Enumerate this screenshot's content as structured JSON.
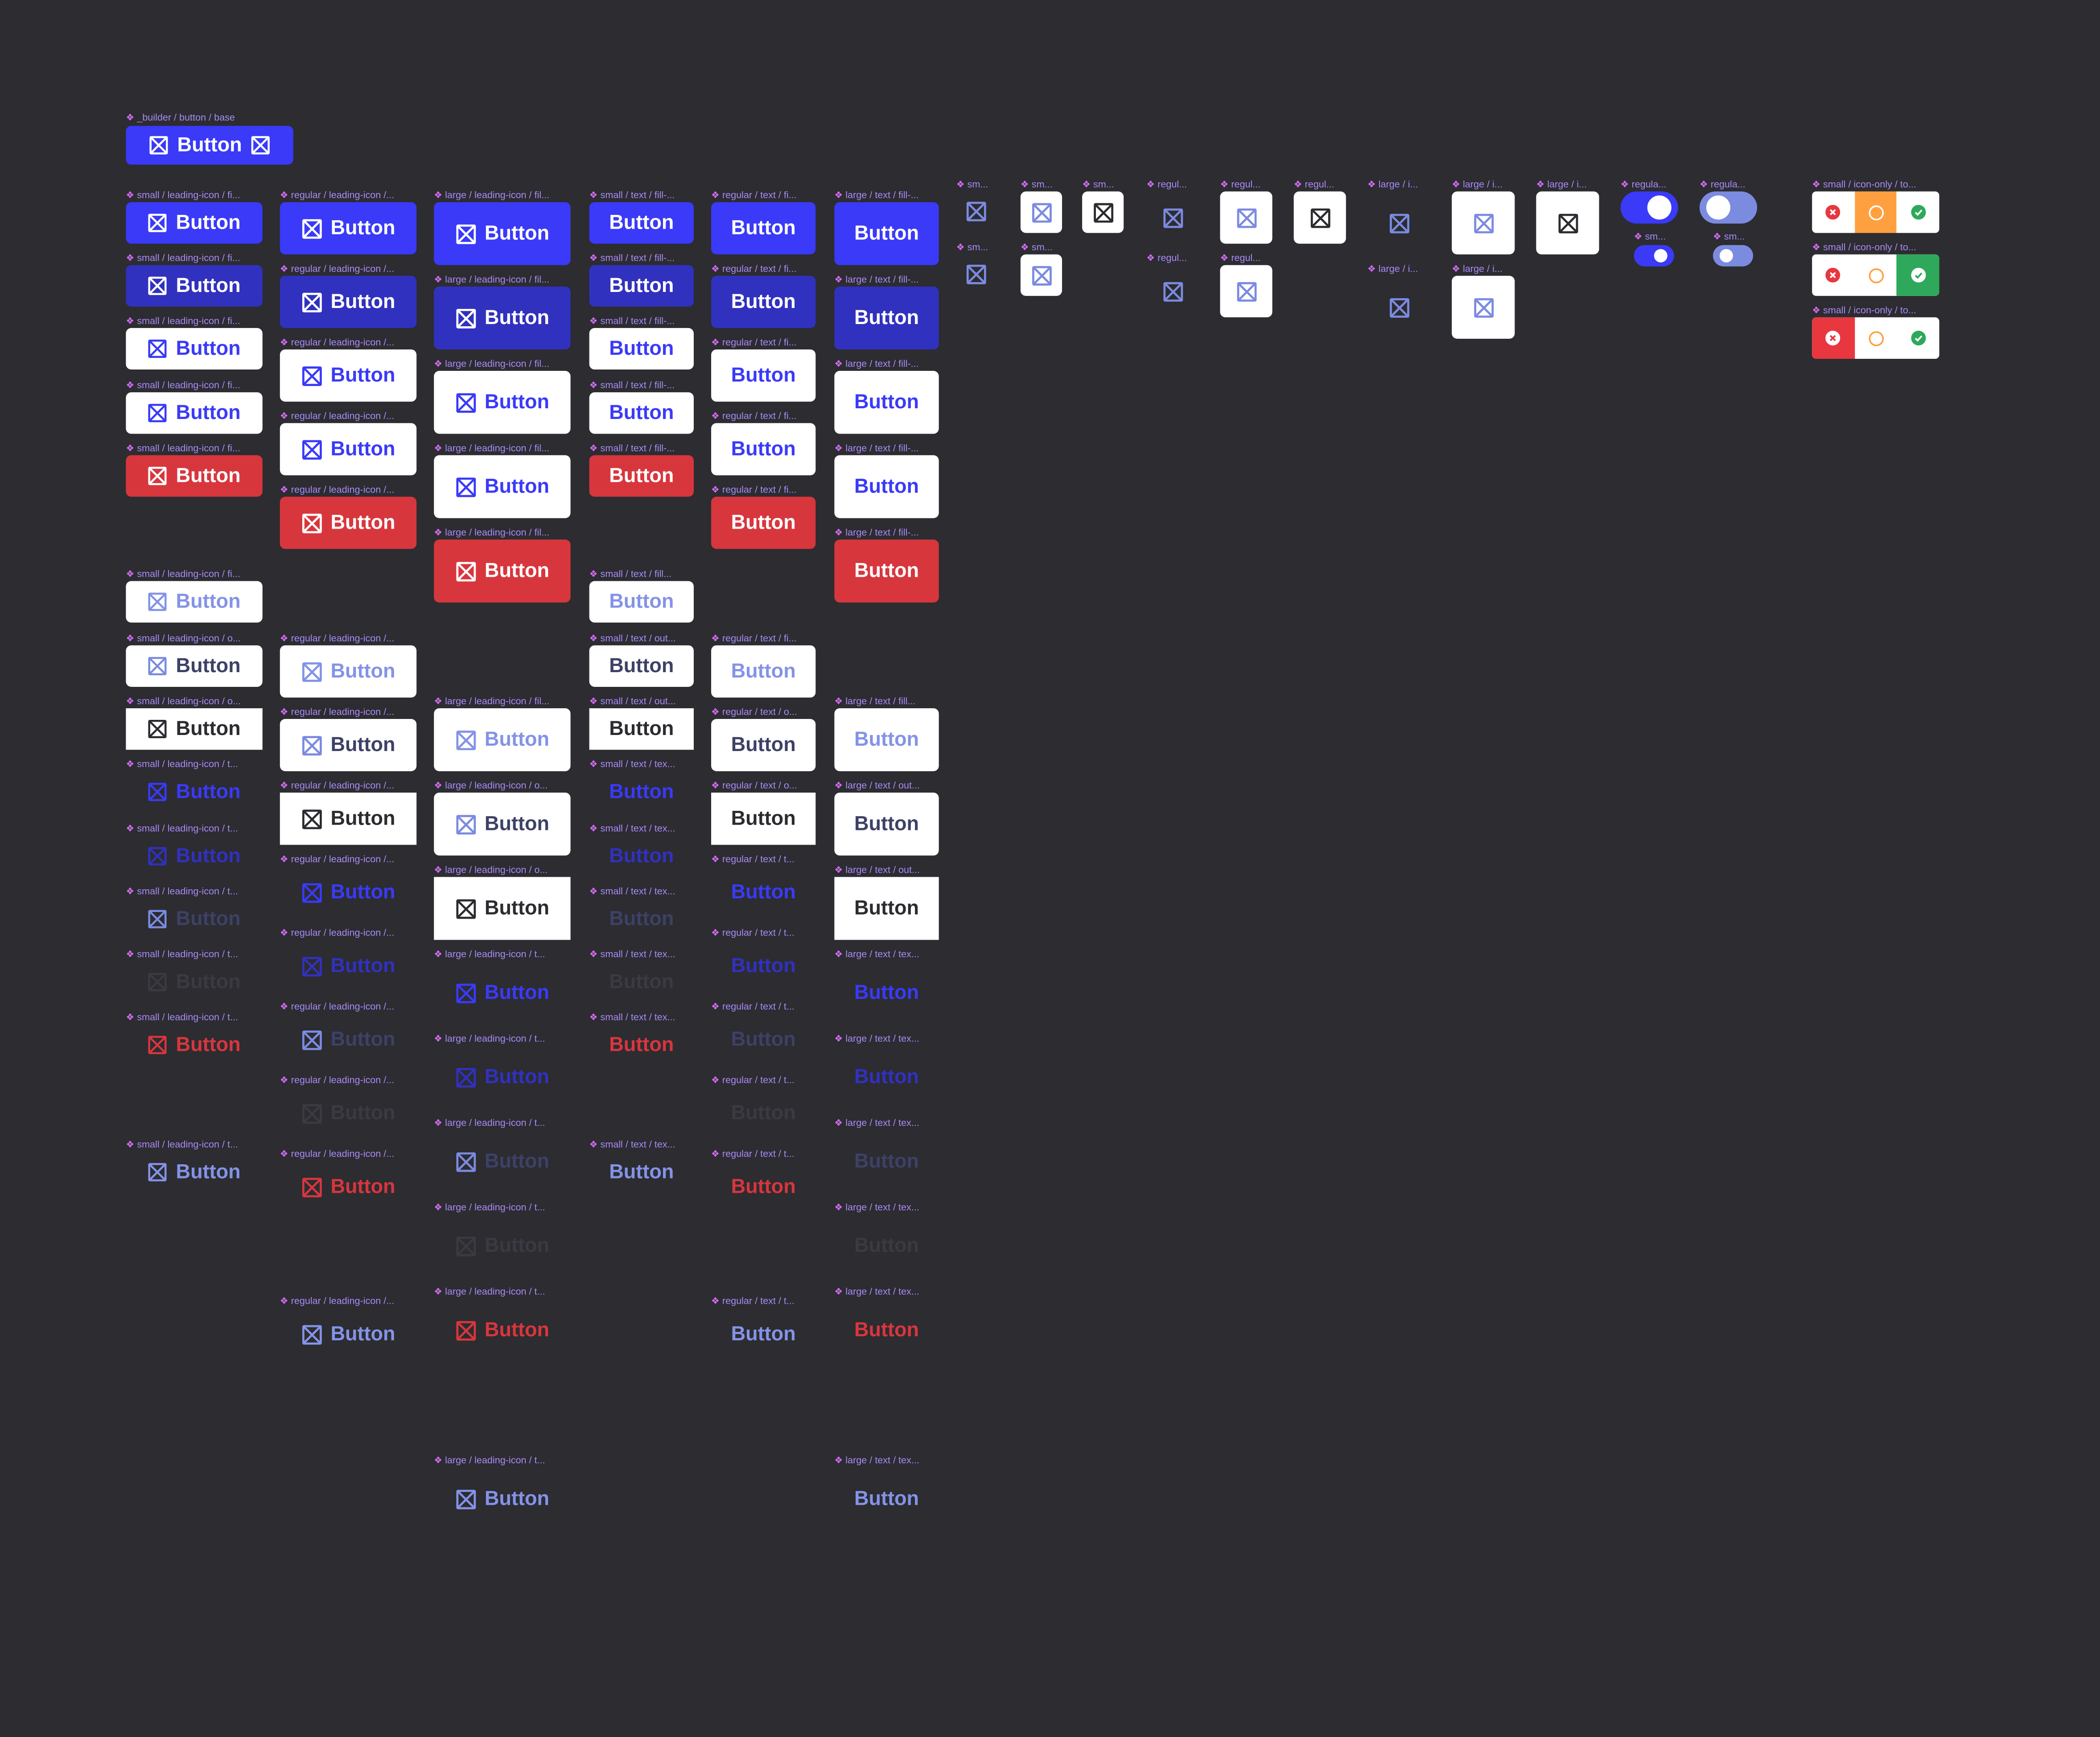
{
  "colors": {
    "background": "#2c2c31",
    "primary": "#3a3af8",
    "pressed": "#3131bf",
    "danger": "#d8363d",
    "muted": "#8493e6",
    "label": "#a98af5",
    "warning": "#ffa040",
    "success": "#2ea85a"
  },
  "builder": {
    "label": "_builder / button / base",
    "text": "Button",
    "icon": "placeholder-x-box-icon"
  },
  "columns": [
    {
      "size": "small",
      "kind": "leading-icon",
      "items": [
        {
          "label": "small / leading-icon / fi...",
          "text": "Button",
          "variant": "fill"
        },
        {
          "label": "small / leading-icon / fi...",
          "text": "Button",
          "variant": "pressed"
        },
        {
          "label": "small / leading-icon / fi...",
          "text": "Button",
          "variant": "white"
        },
        {
          "label": "small / leading-icon / fi...",
          "text": "Button",
          "variant": "white"
        },
        {
          "label": "small / leading-icon / fi...",
          "text": "Button",
          "variant": "red"
        },
        {
          "label": "small / leading-icon / fi...",
          "text": "Button",
          "variant": "disabled"
        },
        {
          "label": "small / leading-icon / o...",
          "text": "Button",
          "variant": "outline"
        },
        {
          "label": "small / leading-icon / o...",
          "text": "Button",
          "variant": "focus"
        },
        {
          "label": "small / leading-icon / t...",
          "text": "Button",
          "variant": "text"
        },
        {
          "label": "small / leading-icon / t...",
          "text": "Button",
          "variant": "textPressed"
        },
        {
          "label": "small / leading-icon / t...",
          "text": "Button",
          "variant": "textDisabled"
        },
        {
          "label": "small / leading-icon / t...",
          "text": "Button",
          "variant": "textFaint"
        },
        {
          "label": "small / leading-icon / t...",
          "text": "Button",
          "variant": "textRed"
        },
        {
          "label": "small / leading-icon / t...",
          "text": "Button",
          "variant": "textLight"
        }
      ]
    },
    {
      "size": "regular",
      "kind": "leading-icon",
      "items": [
        {
          "label": "regular / leading-icon /...",
          "text": "Button",
          "variant": "fill"
        },
        {
          "label": "regular / leading-icon /...",
          "text": "Button",
          "variant": "pressed"
        },
        {
          "label": "regular / leading-icon /...",
          "text": "Button",
          "variant": "white"
        },
        {
          "label": "regular / leading-icon /...",
          "text": "Button",
          "variant": "white"
        },
        {
          "label": "regular / leading-icon /...",
          "text": "Button",
          "variant": "red"
        },
        {
          "label": "regular / leading-icon /...",
          "text": "Button",
          "variant": "disabled"
        },
        {
          "label": "regular / leading-icon /...",
          "text": "Button",
          "variant": "outline"
        },
        {
          "label": "regular / leading-icon /...",
          "text": "Button",
          "variant": "focus"
        },
        {
          "label": "regular / leading-icon /...",
          "text": "Button",
          "variant": "text"
        },
        {
          "label": "regular / leading-icon /...",
          "text": "Button",
          "variant": "textPressed"
        },
        {
          "label": "regular / leading-icon /...",
          "text": "Button",
          "variant": "textDisabled"
        },
        {
          "label": "regular / leading-icon /...",
          "text": "Button",
          "variant": "textFaint"
        },
        {
          "label": "regular / leading-icon /...",
          "text": "Button",
          "variant": "textRed"
        },
        {
          "label": "regular / leading-icon /...",
          "text": "Button",
          "variant": "textLight"
        }
      ]
    },
    {
      "size": "large",
      "kind": "leading-icon",
      "items": [
        {
          "label": "large / leading-icon / fil...",
          "text": "Button",
          "variant": "fill"
        },
        {
          "label": "large / leading-icon / fil...",
          "text": "Button",
          "variant": "pressed"
        },
        {
          "label": "large / leading-icon / fil...",
          "text": "Button",
          "variant": "white"
        },
        {
          "label": "large / leading-icon / fil...",
          "text": "Button",
          "variant": "white"
        },
        {
          "label": "large / leading-icon / fil...",
          "text": "Button",
          "variant": "red"
        },
        {
          "label": "large / leading-icon / fil...",
          "text": "Button",
          "variant": "disabled"
        },
        {
          "label": "large / leading-icon / o...",
          "text": "Button",
          "variant": "outline"
        },
        {
          "label": "large / leading-icon / o...",
          "text": "Button",
          "variant": "focus"
        },
        {
          "label": "large / leading-icon / t...",
          "text": "Button",
          "variant": "text"
        },
        {
          "label": "large / leading-icon / t...",
          "text": "Button",
          "variant": "textPressed"
        },
        {
          "label": "large / leading-icon / t...",
          "text": "Button",
          "variant": "textDisabled"
        },
        {
          "label": "large / leading-icon / t...",
          "text": "Button",
          "variant": "textFaint"
        },
        {
          "label": "large / leading-icon / t...",
          "text": "Button",
          "variant": "textRed"
        },
        {
          "label": "large / leading-icon / t...",
          "text": "Button",
          "variant": "textLight"
        }
      ]
    },
    {
      "size": "small",
      "kind": "text",
      "items": [
        {
          "label": "small / text / fill-...",
          "text": "Button",
          "variant": "fill"
        },
        {
          "label": "small / text / fill-...",
          "text": "Button",
          "variant": "pressed"
        },
        {
          "label": "small / text / fill-...",
          "text": "Button",
          "variant": "white"
        },
        {
          "label": "small / text / fill-...",
          "text": "Button",
          "variant": "white"
        },
        {
          "label": "small / text / fill-...",
          "text": "Button",
          "variant": "red"
        },
        {
          "label": "small / text / fill...",
          "text": "Button",
          "variant": "disabled"
        },
        {
          "label": "small / text / out...",
          "text": "Button",
          "variant": "outline"
        },
        {
          "label": "small / text / out...",
          "text": "Button",
          "variant": "focus"
        },
        {
          "label": "small / text / tex...",
          "text": "Button",
          "variant": "text"
        },
        {
          "label": "small / text / tex...",
          "text": "Button",
          "variant": "textPressed"
        },
        {
          "label": "small / text / tex...",
          "text": "Button",
          "variant": "textDisabled"
        },
        {
          "label": "small / text / tex...",
          "text": "Button",
          "variant": "textFaint"
        },
        {
          "label": "small / text / tex...",
          "text": "Button",
          "variant": "textRed"
        },
        {
          "label": "small / text / tex...",
          "text": "Button",
          "variant": "textLight"
        }
      ]
    },
    {
      "size": "regular",
      "kind": "text",
      "items": [
        {
          "label": "regular / text / fi...",
          "text": "Button",
          "variant": "fill"
        },
        {
          "label": "regular / text / fi...",
          "text": "Button",
          "variant": "pressed"
        },
        {
          "label": "regular / text / fi...",
          "text": "Button",
          "variant": "white"
        },
        {
          "label": "regular / text / fi...",
          "text": "Button",
          "variant": "white"
        },
        {
          "label": "regular / text / fi...",
          "text": "Button",
          "variant": "red"
        },
        {
          "label": "regular / text / fi...",
          "text": "Button",
          "variant": "disabled"
        },
        {
          "label": "regular / text / o...",
          "text": "Button",
          "variant": "outline"
        },
        {
          "label": "regular / text / o...",
          "text": "Button",
          "variant": "focus"
        },
        {
          "label": "regular / text / t...",
          "text": "Button",
          "variant": "text"
        },
        {
          "label": "regular / text / t...",
          "text": "Button",
          "variant": "textPressed"
        },
        {
          "label": "regular / text / t...",
          "text": "Button",
          "variant": "textDisabled"
        },
        {
          "label": "regular / text / t...",
          "text": "Button",
          "variant": "textFaint"
        },
        {
          "label": "regular / text / t...",
          "text": "Button",
          "variant": "textRed"
        },
        {
          "label": "regular / text / t...",
          "text": "Button",
          "variant": "textLight"
        }
      ]
    },
    {
      "size": "large",
      "kind": "text",
      "items": [
        {
          "label": "large / text / fill-...",
          "text": "Button",
          "variant": "fill"
        },
        {
          "label": "large / text / fill-...",
          "text": "Button",
          "variant": "pressed"
        },
        {
          "label": "large / text / fill-...",
          "text": "Button",
          "variant": "white"
        },
        {
          "label": "large / text / fill-...",
          "text": "Button",
          "variant": "white"
        },
        {
          "label": "large / text / fill-...",
          "text": "Button",
          "variant": "red"
        },
        {
          "label": "large / text / fill...",
          "text": "Button",
          "variant": "disabled"
        },
        {
          "label": "large / text / out...",
          "text": "Button",
          "variant": "outline"
        },
        {
          "label": "large / text / out...",
          "text": "Button",
          "variant": "focus"
        },
        {
          "label": "large / text / tex...",
          "text": "Button",
          "variant": "text"
        },
        {
          "label": "large / text / tex...",
          "text": "Button",
          "variant": "textPressed"
        },
        {
          "label": "large / text / tex...",
          "text": "Button",
          "variant": "textDisabled"
        },
        {
          "label": "large / text / tex...",
          "text": "Button",
          "variant": "textFaint"
        },
        {
          "label": "large / text / tex...",
          "text": "Button",
          "variant": "textRed"
        },
        {
          "label": "large / text / tex...",
          "text": "Button",
          "variant": "textLight"
        }
      ]
    }
  ],
  "icon_only": [
    {
      "label": "sm...",
      "style": "ghost"
    },
    {
      "label": "sm...",
      "style": "white"
    },
    {
      "label": "sm...",
      "style": "dark"
    },
    {
      "label": "sm...",
      "style": "ghost"
    },
    {
      "label": "sm...",
      "style": "white"
    },
    {
      "label": "regul...",
      "style": "ghost"
    },
    {
      "label": "regul...",
      "style": "white"
    },
    {
      "label": "regul...",
      "style": "dark"
    },
    {
      "label": "regul...",
      "style": "ghost"
    },
    {
      "label": "regul...",
      "style": "white"
    },
    {
      "label": "large / i...",
      "style": "ghost"
    },
    {
      "label": "large / i...",
      "style": "white"
    },
    {
      "label": "large / i...",
      "style": "dark"
    },
    {
      "label": "large / i...",
      "style": "ghost"
    },
    {
      "label": "large / i...",
      "style": "white"
    }
  ],
  "toggles": [
    {
      "label": "regula...",
      "on": true
    },
    {
      "label": "regula...",
      "on": false
    },
    {
      "label": "sm...",
      "on": true
    },
    {
      "label": "sm...",
      "on": false
    }
  ],
  "segmented": [
    {
      "label": "small / icon-only / to...",
      "selected": "pending"
    },
    {
      "label": "small / icon-only / to...",
      "selected": "success"
    },
    {
      "label": "small / icon-only / to...",
      "selected": "error"
    }
  ]
}
